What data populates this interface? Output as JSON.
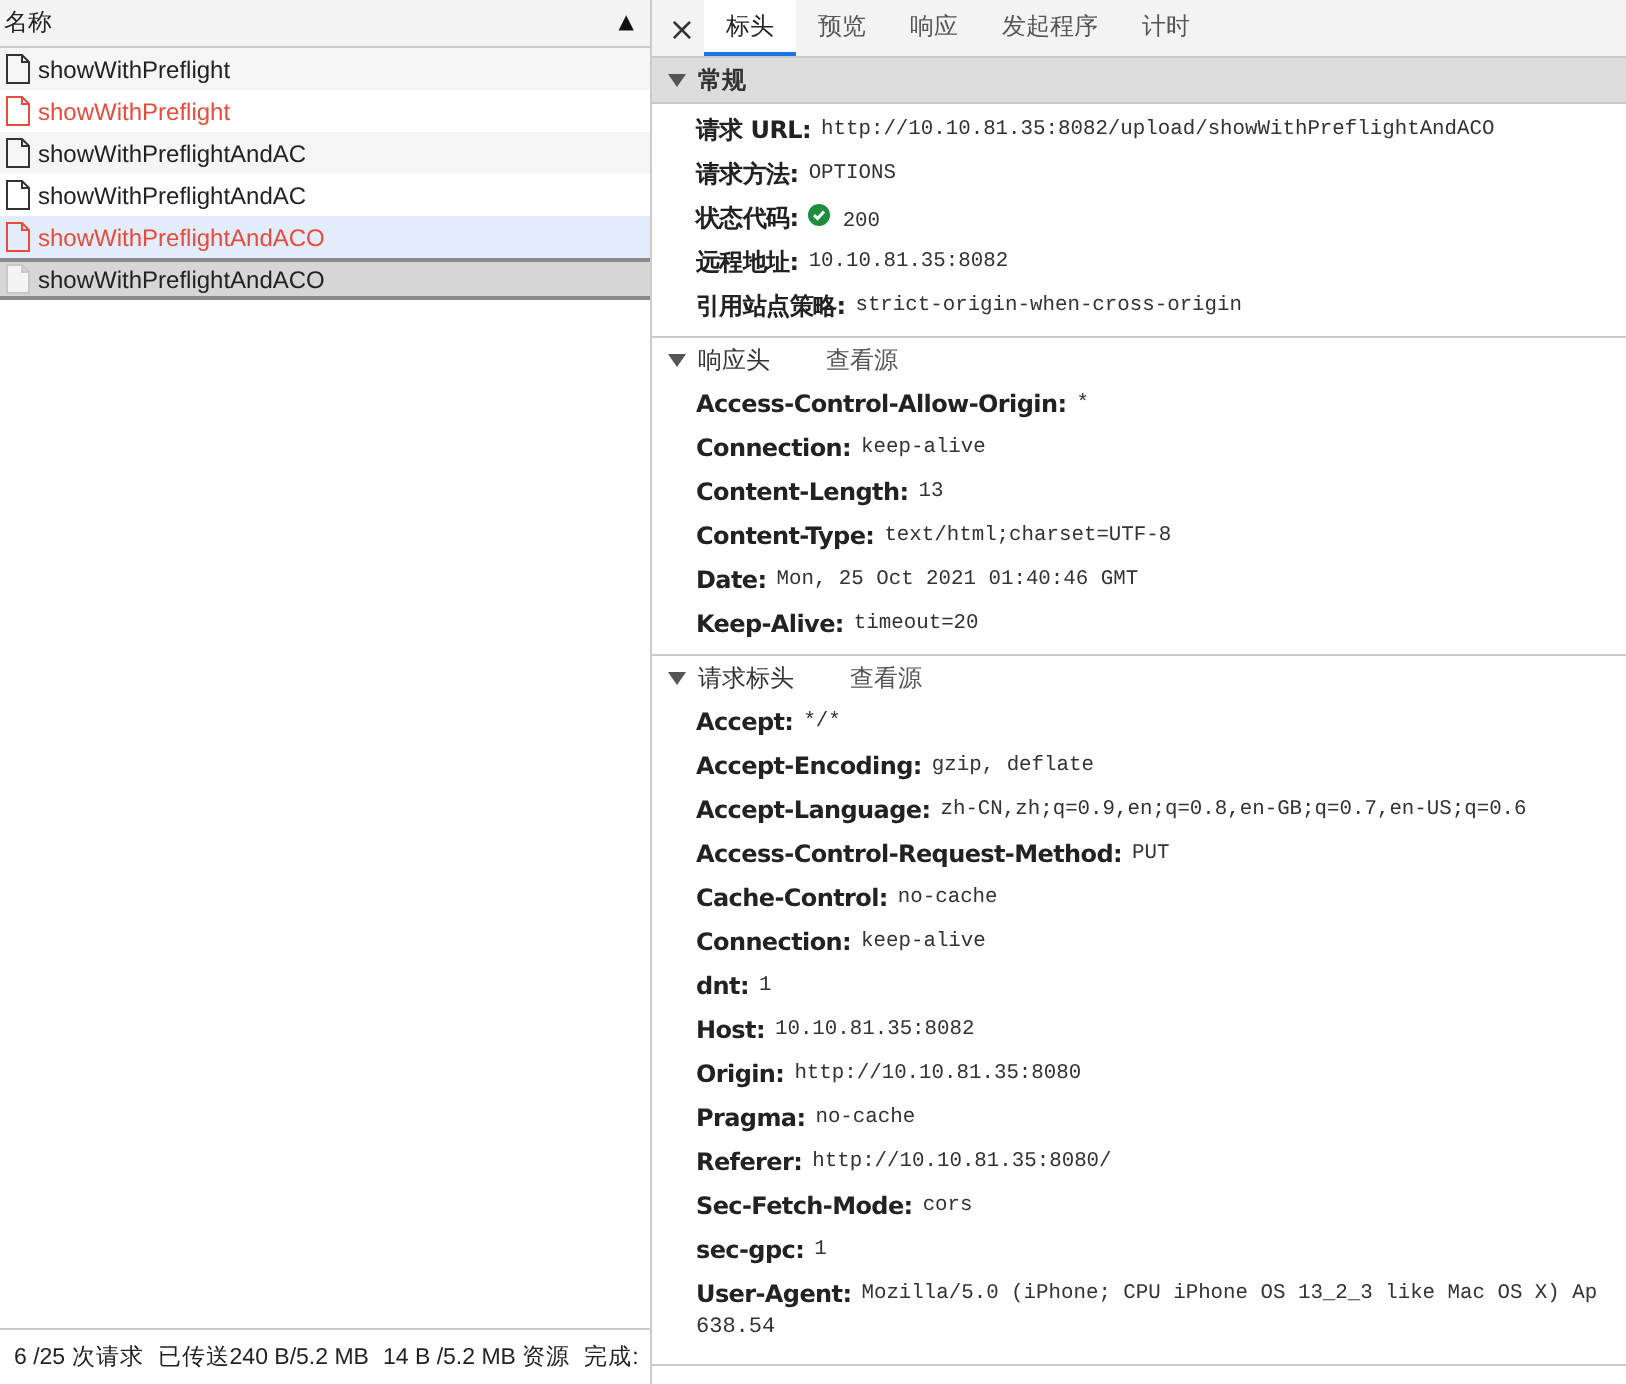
{
  "request_list": {
    "column_header": "名称",
    "sort_icon": "▲",
    "rows": [
      {
        "name": "showWithPreflight",
        "failed": false,
        "selected": false,
        "hovered": false
      },
      {
        "name": "showWithPreflight",
        "failed": true,
        "selected": false,
        "hovered": false
      },
      {
        "name": "showWithPreflightAndAC",
        "failed": false,
        "selected": false,
        "hovered": false
      },
      {
        "name": "showWithPreflightAndAC",
        "failed": false,
        "selected": false,
        "hovered": false
      },
      {
        "name": "showWithPreflightAndACO",
        "failed": true,
        "selected": false,
        "hovered": true
      },
      {
        "name": "showWithPreflightAndACO",
        "failed": false,
        "selected": true,
        "hovered": false
      }
    ]
  },
  "status_bar": [
    "6 /25 次请求",
    "已传送240 B/5.2 MB",
    "14 B /5.2 MB 资源",
    "完成:"
  ],
  "details": {
    "close": "×",
    "tabs": [
      {
        "label": "标头",
        "selected": true
      },
      {
        "label": "预览",
        "selected": false
      },
      {
        "label": "响应",
        "selected": false
      },
      {
        "label": "发起程序",
        "selected": false
      },
      {
        "label": "计时",
        "selected": false
      }
    ],
    "sections": [
      {
        "title": "常规",
        "kind": "general",
        "expanded": true,
        "fields": [
          {
            "name": "请求 URL:",
            "value": "http://10.10.81.35:8082/upload/showWithPreflightAndACO"
          },
          {
            "name": "请求方法:",
            "value": "OPTIONS"
          },
          {
            "name": "状态代码:",
            "value": "200",
            "ok": true
          },
          {
            "name": "远程地址:",
            "value": "10.10.81.35:8082"
          },
          {
            "name": "引用站点策略:",
            "value": "strict-origin-when-cross-origin"
          }
        ]
      },
      {
        "title": "响应头",
        "kind": "headers",
        "expanded": true,
        "action": "查看源",
        "fields": [
          {
            "name": "Access-Control-Allow-Origin:",
            "value": "*"
          },
          {
            "name": "Connection:",
            "value": "keep-alive"
          },
          {
            "name": "Content-Length:",
            "value": "13"
          },
          {
            "name": "Content-Type:",
            "value": "text/html;charset=UTF-8"
          },
          {
            "name": "Date:",
            "value": "Mon, 25 Oct 2021 01:40:46 GMT"
          },
          {
            "name": "Keep-Alive:",
            "value": "timeout=20"
          }
        ]
      },
      {
        "title": "请求标头",
        "kind": "headers",
        "expanded": true,
        "action": "查看源",
        "fields": [
          {
            "name": "Accept:",
            "value": "*/*"
          },
          {
            "name": "Accept-Encoding:",
            "value": "gzip, deflate"
          },
          {
            "name": "Accept-Language:",
            "value": "zh-CN,zh;q=0.9,en;q=0.8,en-GB;q=0.7,en-US;q=0.6"
          },
          {
            "name": "Access-Control-Request-Method:",
            "value": "PUT"
          },
          {
            "name": "Cache-Control:",
            "value": "no-cache"
          },
          {
            "name": "Connection:",
            "value": "keep-alive"
          },
          {
            "name": "dnt:",
            "value": "1"
          },
          {
            "name": "Host:",
            "value": "10.10.81.35:8082"
          },
          {
            "name": "Origin:",
            "value": "http://10.10.81.35:8080"
          },
          {
            "name": "Pragma:",
            "value": "no-cache"
          },
          {
            "name": "Referer:",
            "value": "http://10.10.81.35:8080/"
          },
          {
            "name": "Sec-Fetch-Mode:",
            "value": "cors"
          },
          {
            "name": "sec-gpc:",
            "value": "1"
          },
          {
            "name": "User-Agent:",
            "value": "Mozilla/5.0 (iPhone; CPU iPhone OS 13_2_3 like Mac OS X) Ap",
            "continuation": "638.54"
          }
        ]
      }
    ]
  }
}
